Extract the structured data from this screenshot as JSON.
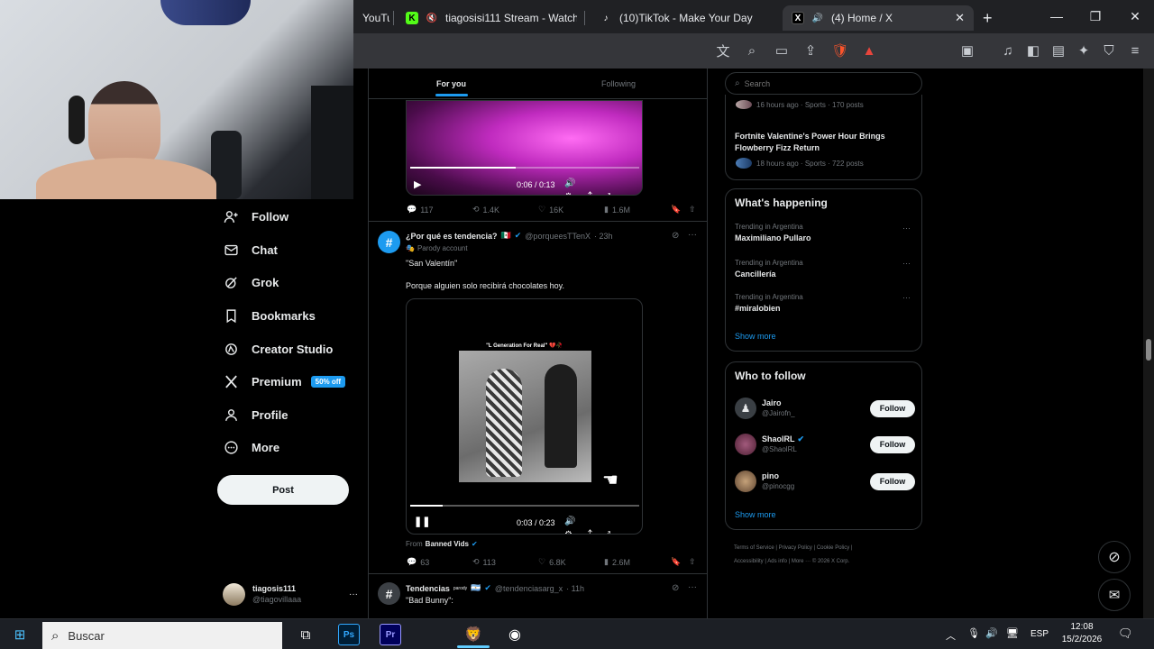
{
  "browser": {
    "tabs": [
      {
        "label": "YouTu",
        "icon": "youtube-icon"
      },
      {
        "label": "tiagosisi111 Stream - Watch L",
        "icon": "kick-icon"
      },
      {
        "label": "(10)TikTok - Make Your Day",
        "icon": "tiktok-icon"
      },
      {
        "label": "(4) Home / X",
        "icon": "x-icon"
      }
    ],
    "new_tab": "+"
  },
  "header_tabs": {
    "for_you": "For you",
    "following": "Following"
  },
  "sidebar": {
    "items": [
      {
        "label": "Follow",
        "icon": "person-plus-icon"
      },
      {
        "label": "Chat",
        "icon": "mail-icon"
      },
      {
        "label": "Grok",
        "icon": "grok-icon"
      },
      {
        "label": "Bookmarks",
        "icon": "bookmark-icon"
      },
      {
        "label": "Creator Studio",
        "icon": "creator-icon"
      },
      {
        "label": "Premium",
        "icon": "x-logo-icon",
        "badge": "50% off"
      },
      {
        "label": "Profile",
        "icon": "person-icon"
      },
      {
        "label": "More",
        "icon": "more-circle-icon"
      }
    ],
    "post_button": "Post",
    "account": {
      "name": "tiagosis111",
      "handle": "@tiagovillaaa",
      "more": "···"
    }
  },
  "feed": {
    "top_video": {
      "time": "0:06 / 0:13"
    },
    "top_actions": {
      "replies": "117",
      "reposts": "1.4K",
      "likes": "16K",
      "views": "1.6M"
    },
    "tweet": {
      "name": "¿Por qué es tendencia?",
      "handle": "@porqueesTTenX",
      "time": "· 23h",
      "parody": "Parody account",
      "line1": "\"San Valentín\"",
      "line2": "Porque alguien solo recibirá chocolates hoy.",
      "video_caption": "\"L Generation For Real\" 💔🥀",
      "video_time": "0:03 / 0:23",
      "from_label": "From",
      "from_name": "Banned Vids",
      "actions": {
        "replies": "63",
        "reposts": "113",
        "likes": "6.8K",
        "views": "2.6M"
      }
    },
    "next_tweet": {
      "name": "Tendencias",
      "parody_tag": "parody",
      "handle": "@tendenciasarg_x",
      "time": "· 11h",
      "text": "\"Bad Bunny\":"
    }
  },
  "right": {
    "search_placeholder": "Search",
    "trend_top": {
      "meta1": "16 hours ago · Sports · 170 posts",
      "title": "Fortnite Valentine's Power Hour Brings Flowberry Fizz Return",
      "meta2": "18 hours ago · Sports · 722 posts"
    },
    "whats_happening": {
      "title": "What's happening",
      "items": [
        {
          "context": "Trending in Argentina",
          "name": "Maximiliano Pullaro"
        },
        {
          "context": "Trending in Argentina",
          "name": "Cancillería"
        },
        {
          "context": "Trending in Argentina",
          "name": "#miralobien"
        }
      ],
      "show_more": "Show more"
    },
    "who_to_follow": {
      "title": "Who to follow",
      "users": [
        {
          "name": "Jairo",
          "handle": "@Jairofn_",
          "button": "Follow",
          "color": "#3a3f44"
        },
        {
          "name": "ShaolRL",
          "handle": "@ShaolRL",
          "button": "Follow",
          "color": "#7a3d5a"
        },
        {
          "name": "pino",
          "handle": "@pinocgg",
          "button": "Follow",
          "color": "#8a6b4a"
        }
      ],
      "show_more": "Show more"
    },
    "footer": [
      "Terms of Service",
      "Privacy Policy",
      "Cookie Policy",
      "Accessibility",
      "Ads info",
      "More ···",
      "© 2026 X Corp."
    ]
  },
  "taskbar": {
    "search_placeholder": "Buscar",
    "lang": "ESP",
    "time": "12:08",
    "date": "15/2/2026",
    "app_ps": "Ps",
    "app_pr": "Pr"
  },
  "colors": {
    "accent": "#1d9bf0",
    "premium_badge": "#1d9bf0",
    "video_purple": "#c02bbf"
  }
}
